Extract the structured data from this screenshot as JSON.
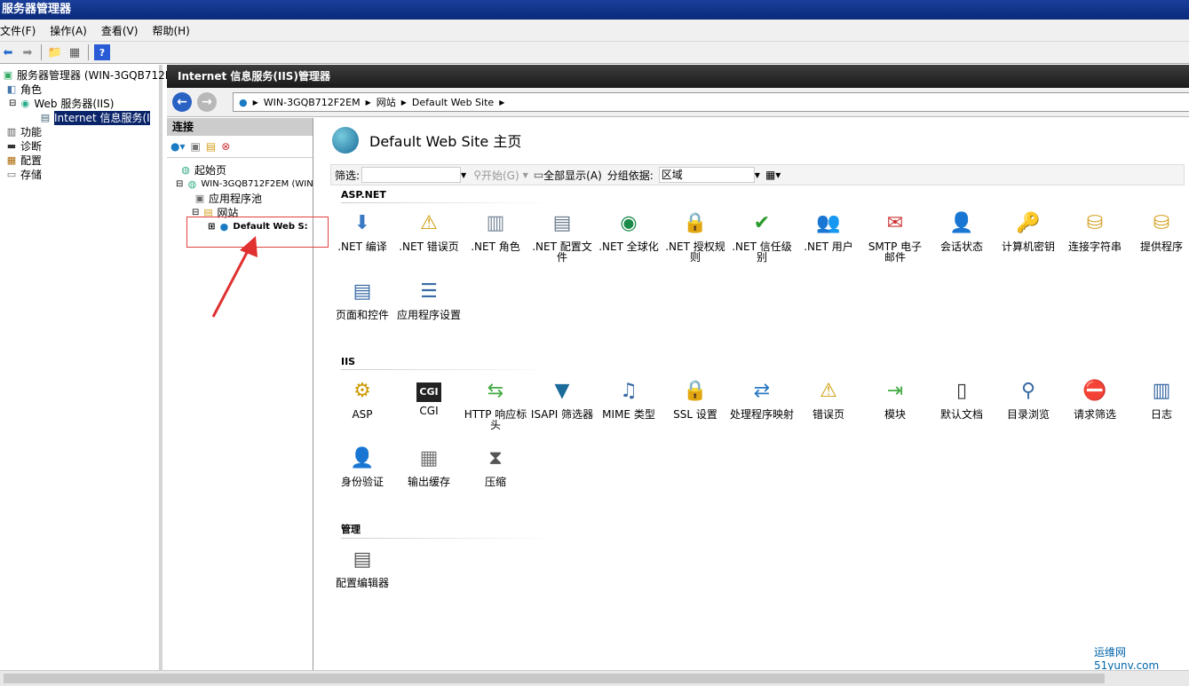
{
  "window": {
    "title": "服务器管理器"
  },
  "menu": [
    "文件(F)",
    "操作(A)",
    "查看(V)",
    "帮助(H)"
  ],
  "toolbar": {
    "icons": [
      "back-arrow-icon",
      "forward-arrow-icon",
      "up-folder-icon",
      "properties-icon",
      "help-icon"
    ]
  },
  "left_tree": {
    "items": [
      {
        "label": "服务器管理器 (WIN-3GQB712F2EM",
        "icon": "server-manager-icon"
      },
      {
        "label": "角色",
        "icon": "roles-icon"
      },
      {
        "label": "Web 服务器(IIS)",
        "icon": "web-server-icon"
      },
      {
        "label": "Internet 信息服务(I",
        "icon": "iis-icon"
      },
      {
        "label": "功能",
        "icon": "features-icon"
      },
      {
        "label": "诊断",
        "icon": "diagnostics-icon"
      },
      {
        "label": "配置",
        "icon": "configuration-icon"
      },
      {
        "label": "存储",
        "icon": "storage-icon"
      }
    ]
  },
  "iis": {
    "header": "Internet 信息服务(IIS)管理器"
  },
  "address": {
    "crumbs": [
      "WIN-3GQB712F2EM",
      "网站",
      "Default Web Site"
    ]
  },
  "connections": {
    "title": "连接",
    "tree": [
      {
        "label": "起始页"
      },
      {
        "label": "WIN-3GQB712F2EM (WIN"
      },
      {
        "label": "应用程序池"
      },
      {
        "label": "网站"
      },
      {
        "label": "Default Web S:"
      }
    ]
  },
  "main": {
    "title": "Default Web Site 主页",
    "filter_label": "筛选:",
    "go_label": "开始(G)",
    "show_all_label": "全部显示(A)",
    "group_label": "分组依据:",
    "group_value": "区域"
  },
  "sections": {
    "aspnet": "ASP.NET",
    "iis": "IIS",
    "manage": "管理"
  },
  "features": {
    "aspnet": [
      ".NET 编译",
      ".NET 错误页",
      ".NET 角色",
      ".NET 配置文件",
      ".NET 全球化",
      ".NET 授权规则",
      ".NET 信任级别",
      ".NET 用户",
      "SMTP 电子邮件",
      "会话状态",
      "计算机密钥",
      "连接字符串",
      "提供程序",
      "页面和控件",
      "应用程序设置"
    ],
    "iis": [
      "ASP",
      "CGI",
      "HTTP 响应标头",
      "ISAPI 筛选器",
      "MIME 类型",
      "SSL 设置",
      "处理程序映射",
      "错误页",
      "模块",
      "默认文档",
      "目录浏览",
      "请求筛选",
      "日志",
      "身份验证",
      "输出缓存",
      "压缩"
    ],
    "manage": [
      "配置编辑器"
    ]
  },
  "watermark": "运维网 51yunv.com"
}
